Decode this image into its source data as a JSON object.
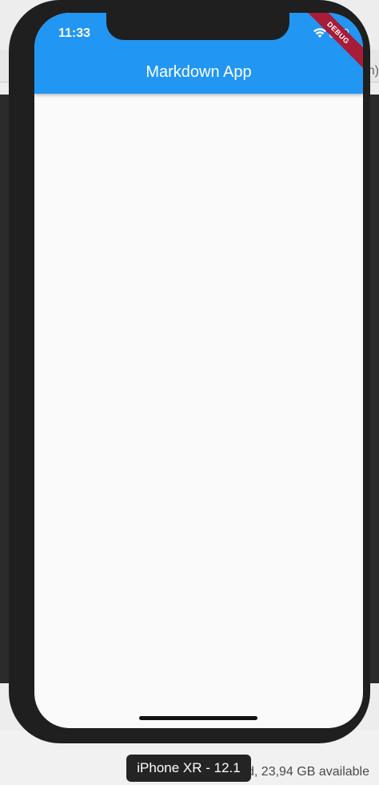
{
  "status_bar": {
    "time": "11:33"
  },
  "app_bar": {
    "title": "Markdown App"
  },
  "debug_banner": {
    "text": "DEBUG"
  },
  "simulator": {
    "device_label": "iPhone XR - 12.1"
  },
  "background": {
    "storage_text": "d, 23,94 GB available",
    "right_tab_fragment": "n)"
  },
  "colors": {
    "app_bar": "#2196f3",
    "debug_banner": "#a61c39",
    "device_frame": "#1f1f1f"
  }
}
